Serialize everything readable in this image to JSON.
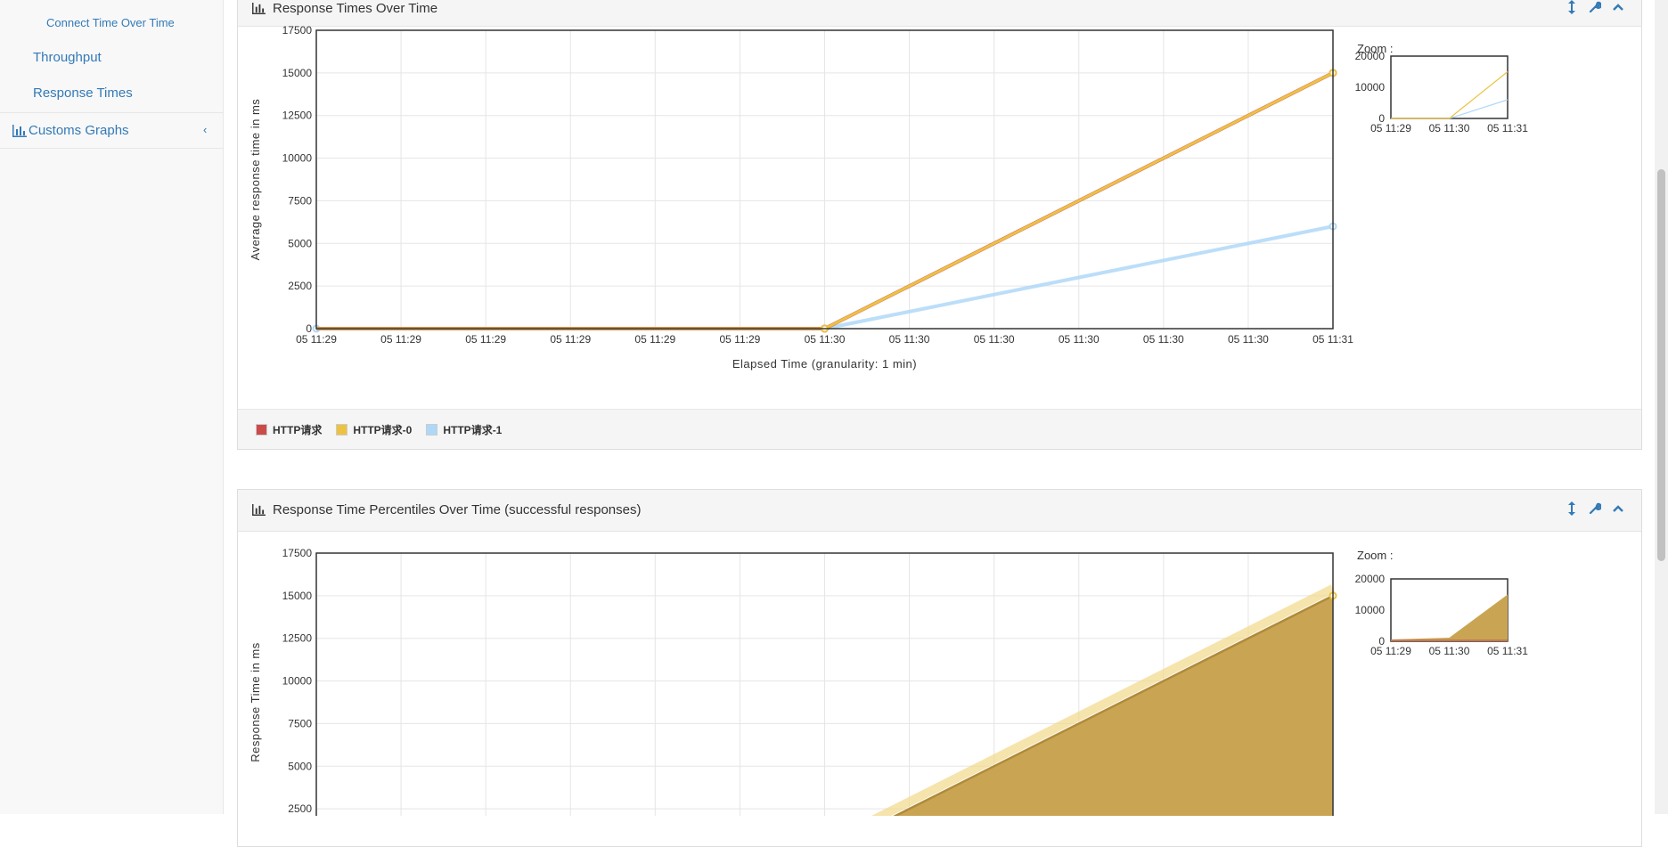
{
  "sidebar": {
    "connect_time": "Connect Time Over Time",
    "throughput": "Throughput",
    "response_times": "Response Times",
    "customs_graphs": "Customs Graphs"
  },
  "panel1": {
    "title": "Response Times Over Time",
    "zoom_label": "Zoom :",
    "legend": [
      "HTTP请求",
      "HTTP请求-0",
      "HTTP请求-1"
    ]
  },
  "panel2": {
    "title": "Response Time Percentiles Over Time (successful responses)",
    "zoom_label": "Zoom :"
  },
  "colors": {
    "series_red": "#cb4b4b",
    "series_orange": "#edc240",
    "series_blue": "#afd8f8",
    "area_fill": "#c9a553",
    "link": "#337ab7"
  },
  "chart_data": [
    {
      "type": "line",
      "title": "Response Times Over Time",
      "xlabel": "Elapsed Time (granularity: 1 min)",
      "ylabel": "Average response time in ms",
      "ylim": [
        0,
        17500
      ],
      "yticks": [
        0,
        2500,
        5000,
        7500,
        10000,
        12500,
        15000,
        17500
      ],
      "xtick_labels": [
        "05 11:29",
        "05 11:29",
        "05 11:29",
        "05 11:29",
        "05 11:29",
        "05 11:29",
        "05 11:30",
        "05 11:30",
        "05 11:30",
        "05 11:30",
        "05 11:30",
        "05 11:30",
        "05 11:31"
      ],
      "x": [
        "05 11:29",
        "05 11:30",
        "05 11:31"
      ],
      "series": [
        {
          "name": "HTTP请求",
          "color": "#cb4b4b",
          "values": [
            0,
            0,
            15000
          ]
        },
        {
          "name": "HTTP请求-0",
          "color": "#edc240",
          "values": [
            0,
            0,
            15000
          ]
        },
        {
          "name": "HTTP请求-1",
          "color": "#afd8f8",
          "values": [
            0,
            0,
            6000
          ]
        }
      ],
      "zoom": {
        "yticks": [
          0,
          10000,
          20000
        ],
        "xticks": [
          "05 11:29",
          "05 11:30",
          "05 11:31"
        ]
      },
      "grid": true,
      "legend": "bottom"
    },
    {
      "type": "area",
      "title": "Response Time Percentiles Over Time (successful responses)",
      "ylabel": "Response Time in ms",
      "ylim": [
        0,
        17500
      ],
      "yticks": [
        2500,
        5000,
        7500,
        10000,
        12500,
        15000,
        17500
      ],
      "x": [
        "05 11:29",
        "05 11:30",
        "05 11:31"
      ],
      "series": [
        {
          "color": "#edc240",
          "values": [
            0,
            0,
            15000
          ]
        }
      ],
      "zoom": {
        "yticks": [
          0,
          10000,
          20000
        ],
        "xticks": [
          "05 11:29",
          "05 11:30",
          "05 11:31"
        ]
      },
      "grid": true
    }
  ]
}
